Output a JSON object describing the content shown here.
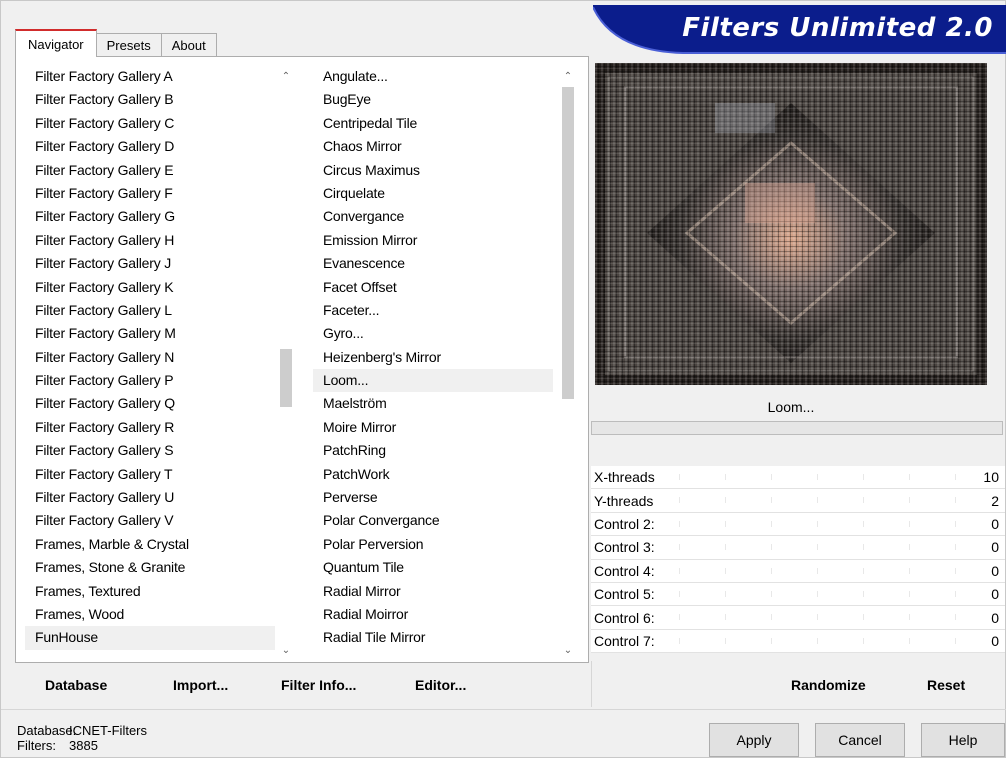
{
  "window": {
    "title": "Filters Unlimited 2.0"
  },
  "tabs": [
    {
      "label": "Navigator",
      "active": true
    },
    {
      "label": "Presets",
      "active": false
    },
    {
      "label": "About",
      "active": false
    }
  ],
  "categories": [
    "Filter Factory Gallery A",
    "Filter Factory Gallery B",
    "Filter Factory Gallery C",
    "Filter Factory Gallery D",
    "Filter Factory Gallery E",
    "Filter Factory Gallery F",
    "Filter Factory Gallery G",
    "Filter Factory Gallery H",
    "Filter Factory Gallery J",
    "Filter Factory Gallery K",
    "Filter Factory Gallery L",
    "Filter Factory Gallery M",
    "Filter Factory Gallery N",
    "Filter Factory Gallery P",
    "Filter Factory Gallery Q",
    "Filter Factory Gallery R",
    "Filter Factory Gallery S",
    "Filter Factory Gallery T",
    "Filter Factory Gallery U",
    "Filter Factory Gallery V",
    "Frames, Marble & Crystal",
    "Frames, Stone & Granite",
    "Frames, Textured",
    "Frames, Wood",
    "FunHouse"
  ],
  "selected_category": "FunHouse",
  "filters": [
    "Angulate...",
    "BugEye",
    "Centripedal Tile",
    "Chaos Mirror",
    "Circus Maximus",
    "Cirquelate",
    "Convergance",
    "Emission Mirror",
    "Evanescence",
    "Facet Offset",
    "Faceter...",
    "Gyro...",
    "Heizenberg's Mirror",
    "Loom...",
    "Maelström",
    "Moire Mirror",
    "PatchRing",
    "PatchWork",
    "Perverse",
    "Polar Convergance",
    "Polar Perversion",
    "Quantum Tile",
    "Radial Mirror",
    "Radial Moirror",
    "Radial Tile Mirror"
  ],
  "selected_filter": "Loom...",
  "left_buttons": {
    "database": "Database",
    "import": "Import...",
    "filter_info": "Filter Info...",
    "editor": "Editor..."
  },
  "preview": {
    "filter_name": "Loom...",
    "progress": 0
  },
  "controls": [
    {
      "label": "X-threads",
      "value": "10"
    },
    {
      "label": "Y-threads",
      "value": "2"
    },
    {
      "label": "Control 2:",
      "value": "0"
    },
    {
      "label": "Control 3:",
      "value": "0"
    },
    {
      "label": "Control 4:",
      "value": "0"
    },
    {
      "label": "Control 5:",
      "value": "0"
    },
    {
      "label": "Control 6:",
      "value": "0"
    },
    {
      "label": "Control 7:",
      "value": "0"
    }
  ],
  "right_buttons": {
    "randomize": "Randomize",
    "reset": "Reset"
  },
  "status": {
    "database_label": "Database:",
    "database_value": "ICNET-Filters",
    "filters_label": "Filters:",
    "filters_value": "3885"
  },
  "dialog_buttons": {
    "apply": "Apply",
    "cancel": "Cancel",
    "help": "Help"
  },
  "colors": {
    "banner": "#0b1d8c",
    "tab_accent": "#d12c2c",
    "preview_bg": "#241f1c"
  }
}
